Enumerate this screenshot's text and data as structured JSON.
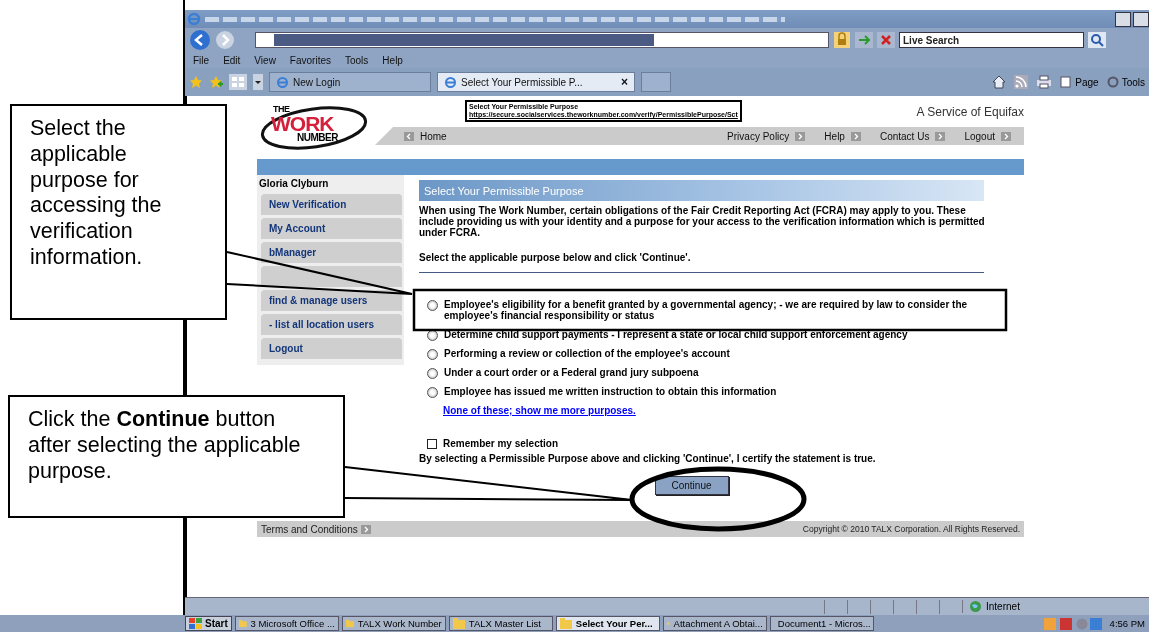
{
  "browser": {
    "search_placeholder": "Live Search",
    "menu": [
      "File",
      "Edit",
      "View",
      "Favorites",
      "Tools",
      "Help"
    ],
    "tabs": [
      {
        "label": "New Login",
        "selected": false
      },
      {
        "label": "Select Your Permissible P...",
        "selected": true
      }
    ],
    "tab_close": "×",
    "commands": [
      "Page",
      "Tools"
    ]
  },
  "page": {
    "logo": [
      "THE",
      "WORK",
      "NUMBER"
    ],
    "tooltip": {
      "title": "Select Your Permissible Purpose",
      "url": "https://secure.socialservices.theworknumber.com/verify/PermissiblePurpose/Sct"
    },
    "service": "A Service of Equifax",
    "nav_home": "Home",
    "nav_links": [
      "Privacy Policy",
      "Help",
      "Contact Us",
      "Logout"
    ],
    "sidebar": {
      "user": "Gloria Clyburn",
      "items": [
        {
          "label": "New Verification"
        },
        {
          "label": "My Account"
        },
        {
          "label": "bManager"
        },
        {
          "label": "find & manage users"
        },
        {
          "label": "- list all location users"
        },
        {
          "label": "Logout"
        }
      ]
    },
    "section_title": "Select Your Permissible Purpose",
    "intro": "When using The Work Number, certain obligations of the Fair Credit Reporting Act (FCRA) may apply to you. These include providing us with your identity and a purpose for your access to the verification information which is permitted under FCRA.",
    "instruction": "Select the applicable purpose below and click 'Continue'.",
    "options": [
      {
        "label": "Employee's eligibility for a benefit granted by a governmental agency; - we are required by law to consider the employee's financial responsibility or status",
        "selected": false
      },
      {
        "label": "Determine child support payments - I represent a state or local child support enforcement agency",
        "selected": false
      },
      {
        "label": "Performing a review or collection of the employee's account",
        "selected": false
      },
      {
        "label": "Under a court order or a Federal grand jury subpoena",
        "selected": false
      },
      {
        "label": "Employee has issued me written instruction to obtain this information",
        "selected": false
      }
    ],
    "more_link": "None of these; show me more purposes.",
    "remember": {
      "label": "Remember my selection",
      "checked": false
    },
    "certify": "By selecting a Permissible Purpose above and clicking 'Continue', I certify the statement is true.",
    "continue_button": "Continue",
    "footer": {
      "terms": "Terms and Conditions",
      "copyright": "Copyright © 2010 TALX Corporation. All Rights Reserved."
    }
  },
  "status_bar": {
    "zone": "Internet"
  },
  "taskbar": {
    "start": "Start",
    "items": [
      {
        "label": "3 Microsoft Office ...",
        "selected": false
      },
      {
        "label": "TALX Work Number",
        "selected": false
      },
      {
        "label": "TALX Master List",
        "selected": false
      },
      {
        "label": "Select Your Per...",
        "selected": true
      },
      {
        "label": "Attachment A  Obtai...",
        "selected": false
      },
      {
        "label": "Document1 - Micros...",
        "selected": false
      }
    ],
    "clock": "4:56 PM"
  },
  "annotations": [
    {
      "kind": "callout",
      "text": "Select the applicable purpose for accessing the verification information."
    },
    {
      "kind": "callout",
      "text": "Click the **Continue** button after selecting the applicable purpose."
    }
  ]
}
